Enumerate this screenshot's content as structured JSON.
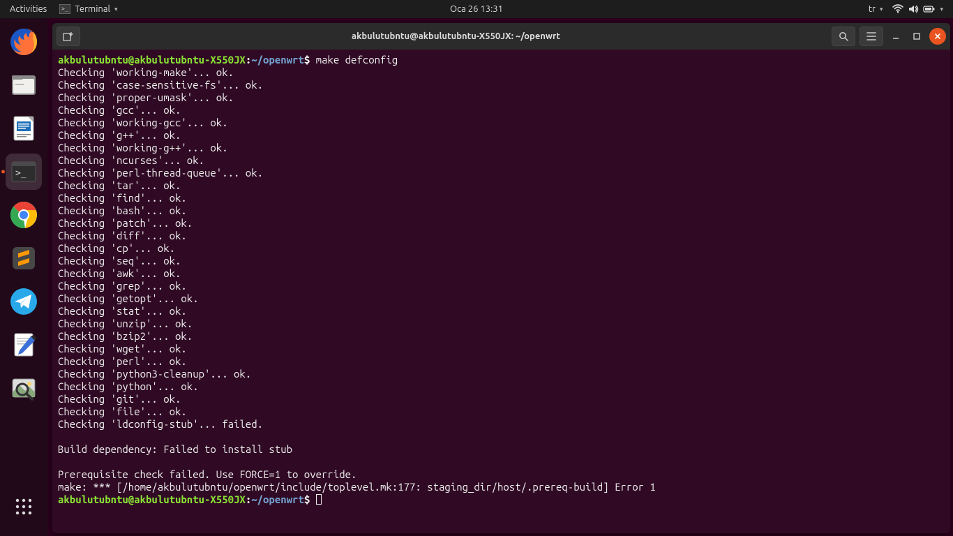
{
  "panel": {
    "activities": "Activities",
    "app_menu": "Terminal",
    "clock": "Oca 26  13:31",
    "lang": "tr"
  },
  "dock": {
    "items": [
      {
        "name": "firefox",
        "active": false
      },
      {
        "name": "files",
        "active": false
      },
      {
        "name": "libreoffice-writer",
        "active": false
      },
      {
        "name": "terminal",
        "active": true
      },
      {
        "name": "chrome",
        "active": false
      },
      {
        "name": "sublime",
        "active": false
      },
      {
        "name": "telegram",
        "active": false
      },
      {
        "name": "xournal",
        "active": false
      },
      {
        "name": "image-viewer",
        "active": false
      }
    ]
  },
  "window": {
    "title": "akbulutubntu@akbulutubntu-X550JX: ~/openwrt",
    "prompt": {
      "user_host": "akbulutubntu@akbulutubntu-X550JX",
      "path": "~/openwrt",
      "symbol": "$"
    },
    "command": "make defconfig",
    "checks": [
      {
        "name": "working-make",
        "status": "ok."
      },
      {
        "name": "case-sensitive-fs",
        "status": "ok."
      },
      {
        "name": "proper-umask",
        "status": "ok."
      },
      {
        "name": "gcc",
        "status": "ok."
      },
      {
        "name": "working-gcc",
        "status": "ok."
      },
      {
        "name": "g++",
        "status": "ok."
      },
      {
        "name": "working-g++",
        "status": "ok."
      },
      {
        "name": "ncurses",
        "status": "ok."
      },
      {
        "name": "perl-thread-queue",
        "status": "ok."
      },
      {
        "name": "tar",
        "status": "ok."
      },
      {
        "name": "find",
        "status": "ok."
      },
      {
        "name": "bash",
        "status": "ok."
      },
      {
        "name": "patch",
        "status": "ok."
      },
      {
        "name": "diff",
        "status": "ok."
      },
      {
        "name": "cp",
        "status": "ok."
      },
      {
        "name": "seq",
        "status": "ok."
      },
      {
        "name": "awk",
        "status": "ok."
      },
      {
        "name": "grep",
        "status": "ok."
      },
      {
        "name": "getopt",
        "status": "ok."
      },
      {
        "name": "stat",
        "status": "ok."
      },
      {
        "name": "unzip",
        "status": "ok."
      },
      {
        "name": "bzip2",
        "status": "ok."
      },
      {
        "name": "wget",
        "status": "ok."
      },
      {
        "name": "perl",
        "status": "ok."
      },
      {
        "name": "python3-cleanup",
        "status": "ok."
      },
      {
        "name": "python",
        "status": "ok."
      },
      {
        "name": "git",
        "status": "ok."
      },
      {
        "name": "file",
        "status": "ok."
      },
      {
        "name": "ldconfig-stub",
        "status": "failed."
      }
    ],
    "messages": {
      "dep_fail": "Build dependency: Failed to install stub",
      "prereq_fail": "Prerequisite check failed. Use FORCE=1 to override.",
      "make_error": "make: *** [/home/akbulutubntu/openwrt/include/toplevel.mk:177: staging_dir/host/.prereq-build] Error 1"
    }
  }
}
